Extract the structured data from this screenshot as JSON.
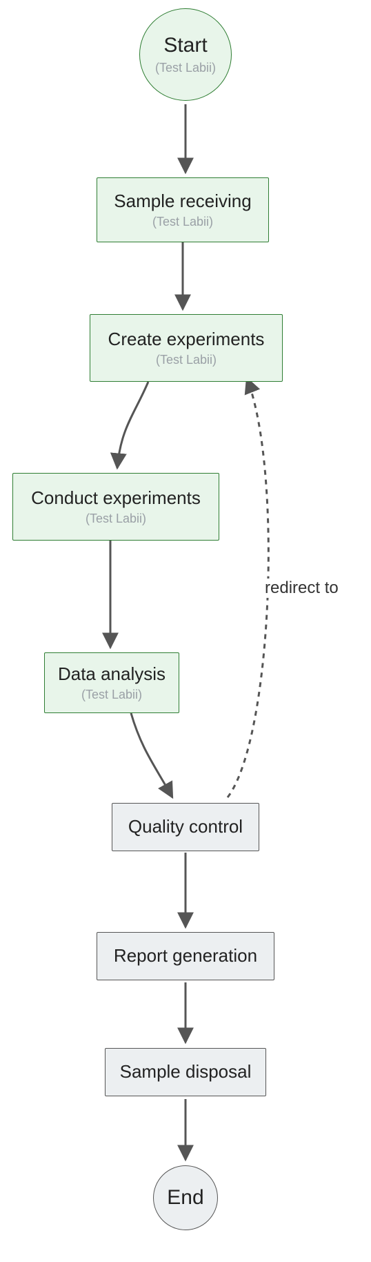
{
  "diagram": {
    "nodes": {
      "start": {
        "title": "Start",
        "sub": "(Test Labii)",
        "type": "terminal-green"
      },
      "receive": {
        "title": "Sample receiving",
        "sub": "(Test Labii)",
        "type": "process-green"
      },
      "create": {
        "title": "Create experiments",
        "sub": "(Test Labii)",
        "type": "process-green"
      },
      "conduct": {
        "title": "Conduct experiments",
        "sub": "(Test Labii)",
        "type": "process-green"
      },
      "analysis": {
        "title": "Data analysis",
        "sub": "(Test Labii)",
        "type": "process-green"
      },
      "qc": {
        "title": "Quality control",
        "type": "process-grey"
      },
      "report": {
        "title": "Report generation",
        "type": "process-grey"
      },
      "disposal": {
        "title": "Sample disposal",
        "type": "process-grey"
      },
      "end": {
        "title": "End",
        "type": "terminal-grey"
      }
    },
    "edges": [
      {
        "from": "start",
        "to": "receive",
        "style": "solid"
      },
      {
        "from": "receive",
        "to": "create",
        "style": "solid"
      },
      {
        "from": "create",
        "to": "conduct",
        "style": "solid"
      },
      {
        "from": "conduct",
        "to": "analysis",
        "style": "solid"
      },
      {
        "from": "analysis",
        "to": "qc",
        "style": "solid"
      },
      {
        "from": "qc",
        "to": "report",
        "style": "solid"
      },
      {
        "from": "report",
        "to": "disposal",
        "style": "solid"
      },
      {
        "from": "disposal",
        "to": "end",
        "style": "solid"
      },
      {
        "from": "qc",
        "to": "create",
        "style": "dashed",
        "label": "redirect to"
      }
    ],
    "colors": {
      "green_fill": "#e8f5ea",
      "green_stroke": "#2e7d32",
      "grey_fill": "#eceff1",
      "grey_stroke": "#555555",
      "arrow": "#555555"
    }
  }
}
